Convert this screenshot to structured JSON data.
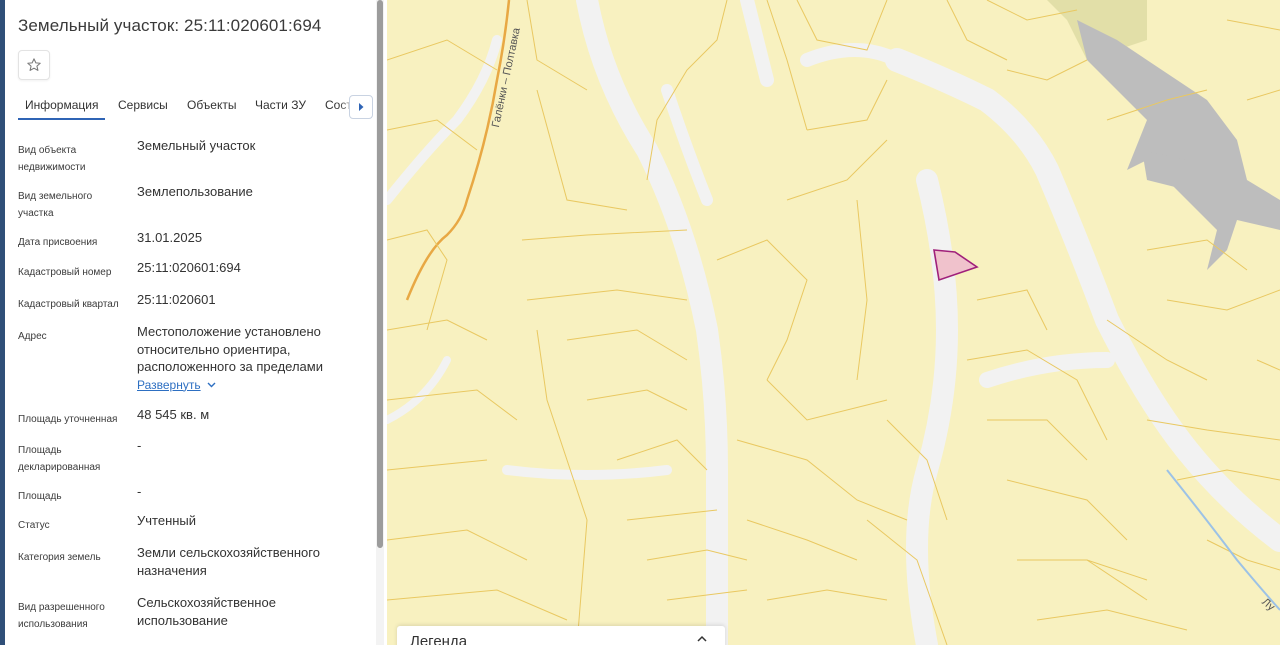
{
  "panel": {
    "title": "Земельный участок: 25:11:020601:694",
    "favorite_icon": "star-outline-icon",
    "tabs": [
      "Информация",
      "Сервисы",
      "Объекты",
      "Части ЗУ",
      "Соста"
    ],
    "active_tab": "Информация",
    "tab_scroll_icon": "caret-right-icon",
    "rows": [
      {
        "label": "Вид объекта недвижимости",
        "value": "Земельный участок"
      },
      {
        "label": "Вид земельного участка",
        "value": "Землепользование"
      },
      {
        "label": "Дата присвоения",
        "value": "31.01.2025"
      },
      {
        "label": "Кадастровый номер",
        "value": "25:11:020601:694"
      },
      {
        "label": "Кадастровый квартал",
        "value": "25:11:020601"
      },
      {
        "label": "Адрес",
        "value": "Местоположение установлено относительно ориентира, расположенного за пределами",
        "expand_label": "Развернуть"
      },
      {
        "label": "Площадь уточненная",
        "value": "48 545 кв. м"
      },
      {
        "label": "Площадь декларированная",
        "value": "-"
      },
      {
        "label": "Площадь",
        "value": "-"
      },
      {
        "label": "Статус",
        "value": "Учтенный"
      },
      {
        "label": "Категория земель",
        "value": "Земли сельскохозяйственного назначения"
      },
      {
        "label": "Вид разрешенного использования",
        "value": "Сельскохозяйственное использование"
      }
    ]
  },
  "map": {
    "road_label": "Галёнки – Полтавка",
    "road_label_2": "Лу",
    "legend_title": "Легенда",
    "legend_toggle_icon": "chevron-up-icon",
    "colors": {
      "parcel_fill": "#f8f1c0",
      "parcel_stroke": "#e8c860",
      "road": "#f2f2f2",
      "water": "#a8c8e8",
      "highlight_fill": "#f0c0c8",
      "highlight_stroke": "#a0207a",
      "industrial": "#b8b8b8"
    }
  }
}
